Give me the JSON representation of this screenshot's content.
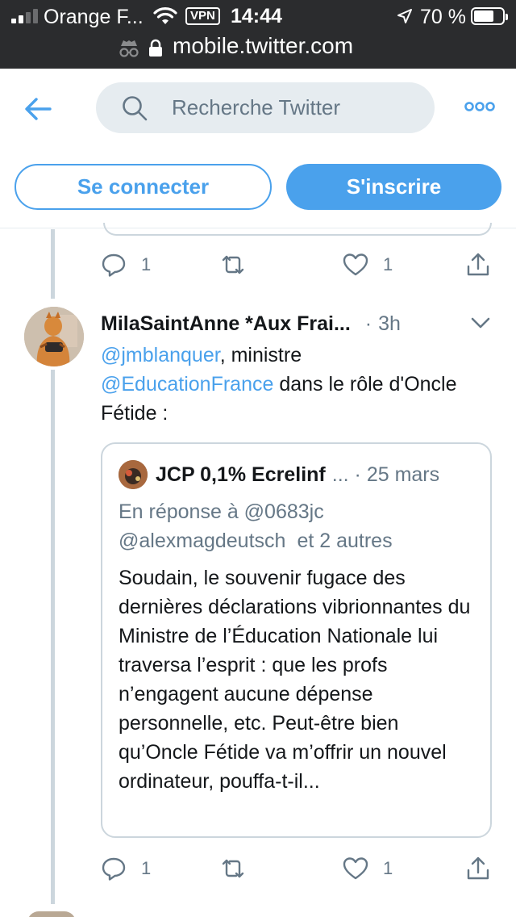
{
  "status_bar": {
    "carrier": "Orange F...",
    "vpn": "VPN",
    "time": "14:44",
    "battery_percent": "70 %",
    "battery_level": 0.7,
    "signal_bars_active": 2,
    "signal_bars_total": 4
  },
  "url_bar": {
    "url": "mobile.twitter.com"
  },
  "header": {
    "search_placeholder": "Recherche Twitter",
    "login_label": "Se connecter",
    "signup_label": "S'inscrire"
  },
  "colors": {
    "accent": "#4aa1ec",
    "system_bar": "#2b2c2e",
    "secondary_text": "#657786",
    "border": "#ccd6dd"
  },
  "icons": [
    "back-arrow-icon",
    "search-icon",
    "more-icon",
    "reply-icon",
    "retweet-icon",
    "like-icon",
    "share-icon",
    "caret-down-icon",
    "lock-icon",
    "incognito-icon",
    "wifi-icon",
    "location-icon"
  ],
  "prev_tweet": {
    "actions": {
      "replies": "1",
      "likes": "1"
    }
  },
  "tweet": {
    "author": "MilaSaintAnne *Aux Frai...",
    "separator": "·",
    "time": "3h",
    "mention_1": "@jmblanquer",
    "text_1": ", ministre",
    "mention_2": "@EducationFrance",
    "text_2": " dans le rôle d'Oncle Fétide :",
    "quote": {
      "author": "JCP 0,1% Ecrelinf",
      "meta": "... · 25 mars",
      "reply_prefix": "En réponse à",
      "reply_user_1": "@0683jc",
      "reply_user_2": "@alexmagdeutsch",
      "reply_others": "et 2 autres",
      "body": "Soudain, le souvenir fugace des dernières déclarations vibrionnantes du Ministre de l’Éducation Nationale lui traversa l’esprit : que les profs n’engagent aucune dépense personnelle, etc. Peut-être bien qu’Oncle Fétide va m’offrir un nouvel ordinateur, pouffa-t-il..."
    },
    "actions": {
      "replies": "1",
      "likes": "1"
    }
  }
}
